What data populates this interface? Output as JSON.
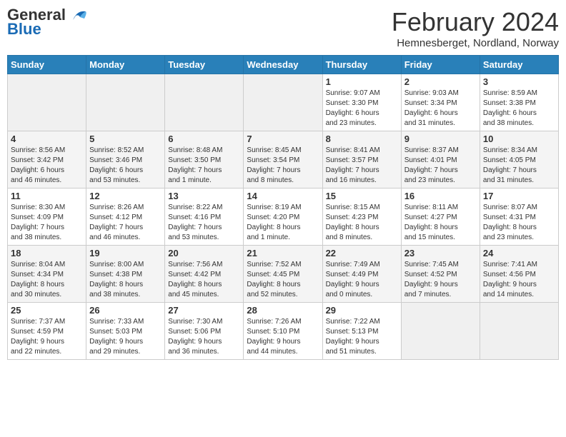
{
  "header": {
    "logo_line1": "General",
    "logo_line2": "Blue",
    "month_title": "February 2024",
    "location": "Hemnesberget, Nordland, Norway"
  },
  "weekdays": [
    "Sunday",
    "Monday",
    "Tuesday",
    "Wednesday",
    "Thursday",
    "Friday",
    "Saturday"
  ],
  "weeks": [
    [
      {
        "day": "",
        "info": ""
      },
      {
        "day": "",
        "info": ""
      },
      {
        "day": "",
        "info": ""
      },
      {
        "day": "",
        "info": ""
      },
      {
        "day": "1",
        "info": "Sunrise: 9:07 AM\nSunset: 3:30 PM\nDaylight: 6 hours\nand 23 minutes."
      },
      {
        "day": "2",
        "info": "Sunrise: 9:03 AM\nSunset: 3:34 PM\nDaylight: 6 hours\nand 31 minutes."
      },
      {
        "day": "3",
        "info": "Sunrise: 8:59 AM\nSunset: 3:38 PM\nDaylight: 6 hours\nand 38 minutes."
      }
    ],
    [
      {
        "day": "4",
        "info": "Sunrise: 8:56 AM\nSunset: 3:42 PM\nDaylight: 6 hours\nand 46 minutes."
      },
      {
        "day": "5",
        "info": "Sunrise: 8:52 AM\nSunset: 3:46 PM\nDaylight: 6 hours\nand 53 minutes."
      },
      {
        "day": "6",
        "info": "Sunrise: 8:48 AM\nSunset: 3:50 PM\nDaylight: 7 hours\nand 1 minute."
      },
      {
        "day": "7",
        "info": "Sunrise: 8:45 AM\nSunset: 3:54 PM\nDaylight: 7 hours\nand 8 minutes."
      },
      {
        "day": "8",
        "info": "Sunrise: 8:41 AM\nSunset: 3:57 PM\nDaylight: 7 hours\nand 16 minutes."
      },
      {
        "day": "9",
        "info": "Sunrise: 8:37 AM\nSunset: 4:01 PM\nDaylight: 7 hours\nand 23 minutes."
      },
      {
        "day": "10",
        "info": "Sunrise: 8:34 AM\nSunset: 4:05 PM\nDaylight: 7 hours\nand 31 minutes."
      }
    ],
    [
      {
        "day": "11",
        "info": "Sunrise: 8:30 AM\nSunset: 4:09 PM\nDaylight: 7 hours\nand 38 minutes."
      },
      {
        "day": "12",
        "info": "Sunrise: 8:26 AM\nSunset: 4:12 PM\nDaylight: 7 hours\nand 46 minutes."
      },
      {
        "day": "13",
        "info": "Sunrise: 8:22 AM\nSunset: 4:16 PM\nDaylight: 7 hours\nand 53 minutes."
      },
      {
        "day": "14",
        "info": "Sunrise: 8:19 AM\nSunset: 4:20 PM\nDaylight: 8 hours\nand 1 minute."
      },
      {
        "day": "15",
        "info": "Sunrise: 8:15 AM\nSunset: 4:23 PM\nDaylight: 8 hours\nand 8 minutes."
      },
      {
        "day": "16",
        "info": "Sunrise: 8:11 AM\nSunset: 4:27 PM\nDaylight: 8 hours\nand 15 minutes."
      },
      {
        "day": "17",
        "info": "Sunrise: 8:07 AM\nSunset: 4:31 PM\nDaylight: 8 hours\nand 23 minutes."
      }
    ],
    [
      {
        "day": "18",
        "info": "Sunrise: 8:04 AM\nSunset: 4:34 PM\nDaylight: 8 hours\nand 30 minutes."
      },
      {
        "day": "19",
        "info": "Sunrise: 8:00 AM\nSunset: 4:38 PM\nDaylight: 8 hours\nand 38 minutes."
      },
      {
        "day": "20",
        "info": "Sunrise: 7:56 AM\nSunset: 4:42 PM\nDaylight: 8 hours\nand 45 minutes."
      },
      {
        "day": "21",
        "info": "Sunrise: 7:52 AM\nSunset: 4:45 PM\nDaylight: 8 hours\nand 52 minutes."
      },
      {
        "day": "22",
        "info": "Sunrise: 7:49 AM\nSunset: 4:49 PM\nDaylight: 9 hours\nand 0 minutes."
      },
      {
        "day": "23",
        "info": "Sunrise: 7:45 AM\nSunset: 4:52 PM\nDaylight: 9 hours\nand 7 minutes."
      },
      {
        "day": "24",
        "info": "Sunrise: 7:41 AM\nSunset: 4:56 PM\nDaylight: 9 hours\nand 14 minutes."
      }
    ],
    [
      {
        "day": "25",
        "info": "Sunrise: 7:37 AM\nSunset: 4:59 PM\nDaylight: 9 hours\nand 22 minutes."
      },
      {
        "day": "26",
        "info": "Sunrise: 7:33 AM\nSunset: 5:03 PM\nDaylight: 9 hours\nand 29 minutes."
      },
      {
        "day": "27",
        "info": "Sunrise: 7:30 AM\nSunset: 5:06 PM\nDaylight: 9 hours\nand 36 minutes."
      },
      {
        "day": "28",
        "info": "Sunrise: 7:26 AM\nSunset: 5:10 PM\nDaylight: 9 hours\nand 44 minutes."
      },
      {
        "day": "29",
        "info": "Sunrise: 7:22 AM\nSunset: 5:13 PM\nDaylight: 9 hours\nand 51 minutes."
      },
      {
        "day": "",
        "info": ""
      },
      {
        "day": "",
        "info": ""
      }
    ]
  ]
}
